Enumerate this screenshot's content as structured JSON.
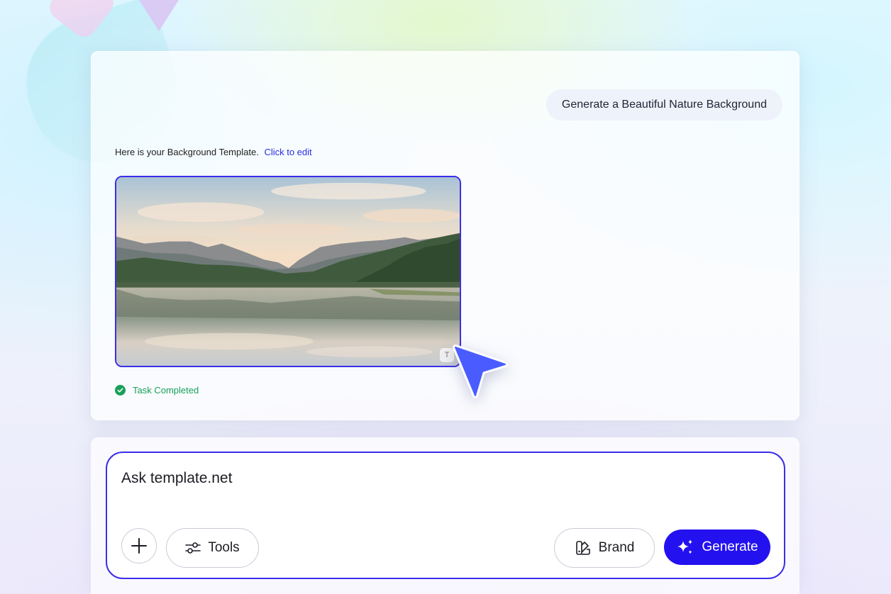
{
  "chat": {
    "user_message": "Generate a Beautiful Nature Background",
    "assistant_intro": "Here is your Background Template.",
    "edit_link": "Click to edit",
    "image_badge": "T",
    "status_text": "Task Completed"
  },
  "composer": {
    "placeholder": "Ask template.net",
    "tools_label": "Tools",
    "brand_label": "Brand",
    "generate_label": "Generate"
  },
  "colors": {
    "accent": "#2411f0",
    "accent_border": "#3b2ee8",
    "success": "#17a05a",
    "cursor": "#4a5cff"
  },
  "icons": {
    "plus": "plus-icon",
    "tools": "sliders-icon",
    "brand": "palette-icon",
    "generate": "sparkle-icon",
    "status": "check-circle-icon",
    "cursor": "pointer-arrow-icon"
  }
}
